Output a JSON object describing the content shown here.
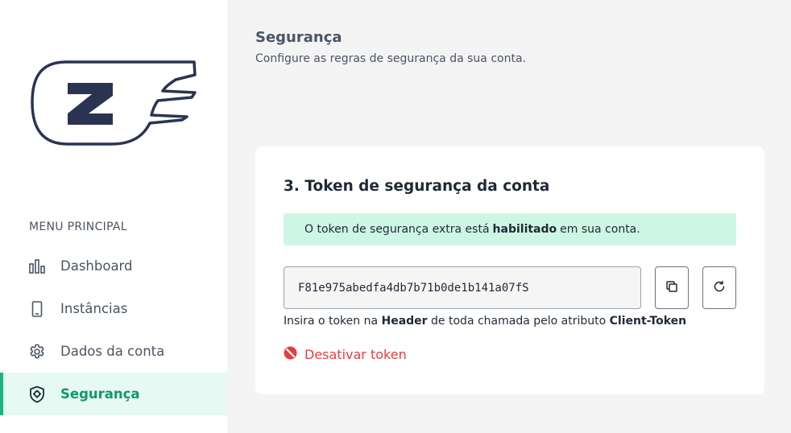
{
  "sidebar": {
    "menu_heading": "MENU PRINCIPAL",
    "items": [
      {
        "label": "Dashboard",
        "icon": "bar-chart-icon"
      },
      {
        "label": "Instâncias",
        "icon": "mobile-device-icon"
      },
      {
        "label": "Dados da conta",
        "icon": "gear-icon"
      },
      {
        "label": "Segurança",
        "icon": "shield-icon",
        "active": true
      }
    ]
  },
  "header": {
    "title": "Segurança",
    "subtitle": "Configure as regras de segurança da sua conta."
  },
  "token_card": {
    "title": "3. Token de segurança da conta",
    "alert": {
      "before": "O token de segurança extra está",
      "bold": "habilitado",
      "after": "em sua conta."
    },
    "token_value": "F81e975abedfa4db7b71b0de1b141a07fS",
    "hint": {
      "p1": "Insira o token na",
      "b1": "Header",
      "p2": "de toda chamada pelo atributo",
      "b2": "Client-Token"
    },
    "deactivate_label": "Desativar token"
  },
  "colors": {
    "accent": "#19b57a",
    "active_bg": "#e6f9f2",
    "alert_bg": "#cdf6e4",
    "danger": "#e53e3e",
    "logo_navy": "#2a3452"
  }
}
